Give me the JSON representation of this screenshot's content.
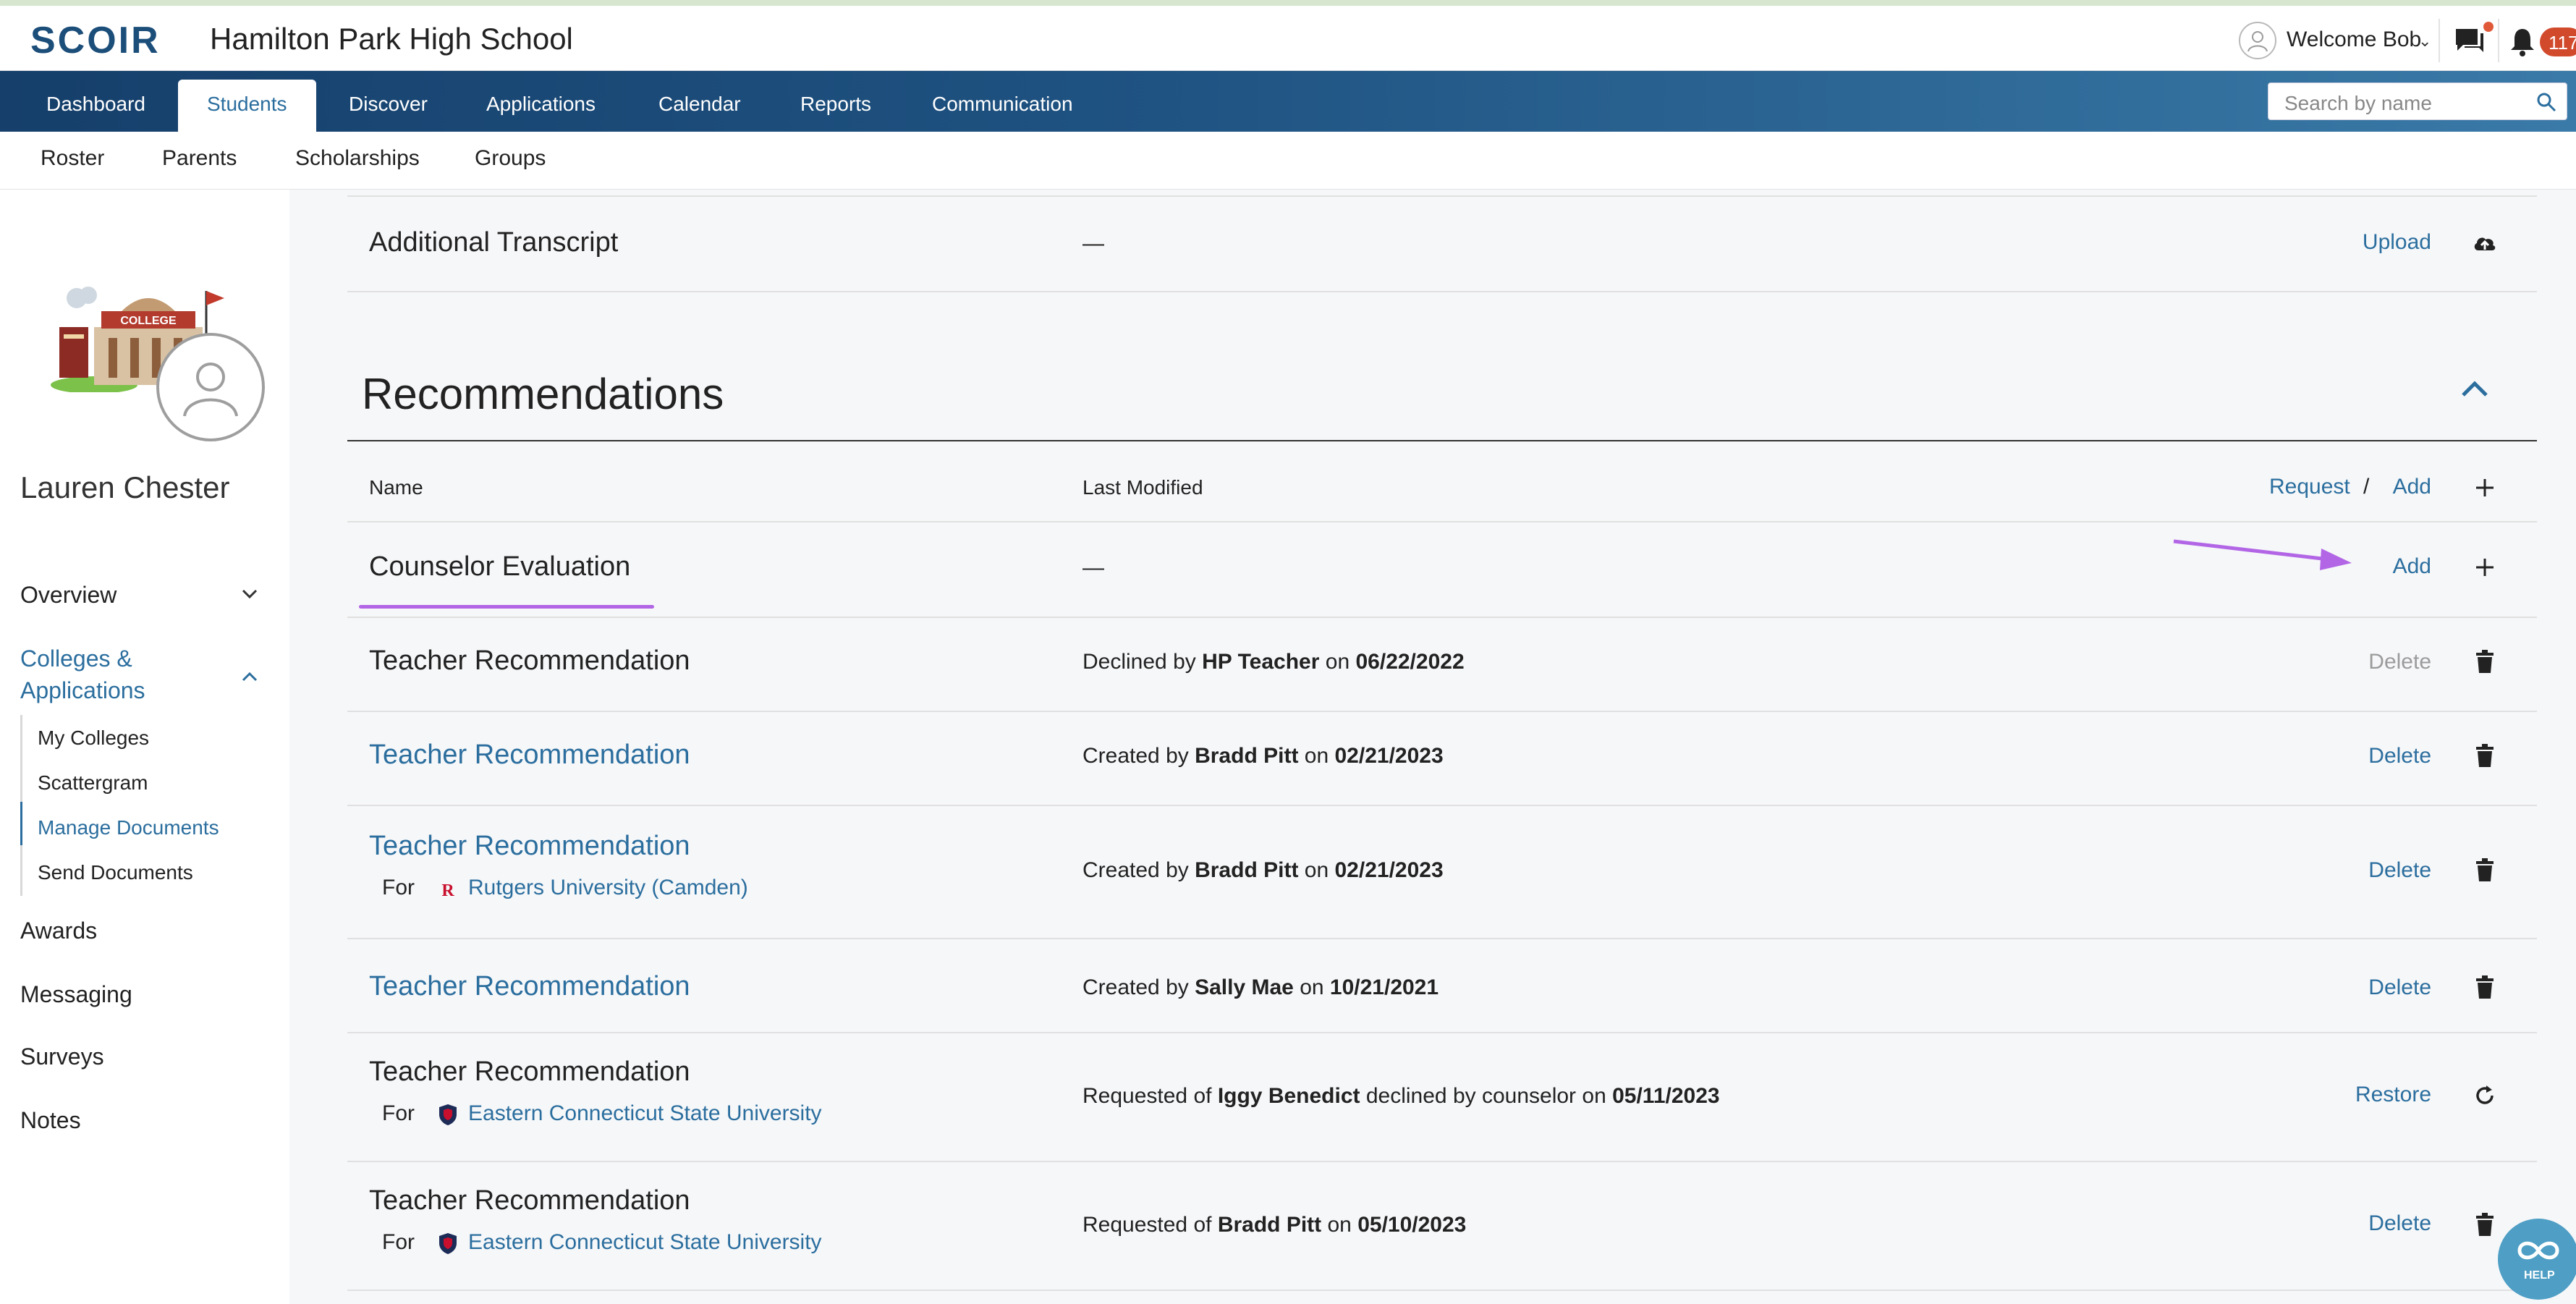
{
  "header": {
    "logo": "SCOIR",
    "school": "Hamilton Park High School",
    "welcome": "Welcome Bob",
    "notification_count": "117",
    "icons": [
      "user-avatar-icon",
      "chevron-down-icon",
      "chat-icon",
      "bell-icon"
    ]
  },
  "nav": {
    "tabs": [
      {
        "label": "Dashboard"
      },
      {
        "label": "Students"
      },
      {
        "label": "Discover"
      },
      {
        "label": "Applications"
      },
      {
        "label": "Calendar"
      },
      {
        "label": "Reports"
      },
      {
        "label": "Communication"
      }
    ],
    "search_placeholder": "Search by name"
  },
  "subnav": {
    "items": [
      {
        "label": "Roster"
      },
      {
        "label": "Parents"
      },
      {
        "label": "Scholarships"
      },
      {
        "label": "Groups"
      }
    ]
  },
  "sidebar": {
    "student_name": "Lauren Chester",
    "overview": "Overview",
    "colleges_line1": "Colleges &",
    "colleges_line2": "Applications",
    "sub_items": [
      {
        "label": "My Colleges"
      },
      {
        "label": "Scattergram"
      },
      {
        "label": "Manage Documents"
      },
      {
        "label": "Send Documents"
      }
    ],
    "awards": "Awards",
    "messaging": "Messaging",
    "surveys": "Surveys",
    "notes": "Notes"
  },
  "transcript": {
    "name": "Additional Transcript",
    "modified": "—",
    "action": "Upload"
  },
  "recommendations": {
    "title": "Recommendations",
    "col_name": "Name",
    "col_modified": "Last Modified",
    "request": "Request",
    "separator": "/",
    "add": "Add",
    "rows": [
      {
        "name": "Counselor Evaluation",
        "modified": "—",
        "action": "Add"
      },
      {
        "name": "Teacher Recommendation",
        "prefix": "Declined by",
        "person": "HP Teacher",
        "on": "on",
        "date": "06/22/2022",
        "action": "Delete"
      },
      {
        "name": "Teacher Recommendation",
        "prefix": "Created by",
        "person": "Bradd Pitt",
        "on": "on",
        "date": "02/21/2023",
        "action": "Delete"
      },
      {
        "name": "Teacher Recommendation",
        "for_label": "For",
        "for_college": "Rutgers University (Camden)",
        "prefix": "Created by",
        "person": "Bradd Pitt",
        "on": "on",
        "date": "02/21/2023",
        "action": "Delete"
      },
      {
        "name": "Teacher Recommendation",
        "prefix": "Created by",
        "person": "Sally Mae",
        "on": "on",
        "date": "10/21/2021",
        "action": "Delete"
      },
      {
        "name": "Teacher Recommendation",
        "for_label": "For",
        "for_college": "Eastern Connecticut State University",
        "prefix": "Requested of",
        "person": "Iggy Benedict",
        "on": "declined by counselor on",
        "date": "05/11/2023",
        "action": "Restore"
      },
      {
        "name": "Teacher Recommendation",
        "for_label": "For",
        "for_college": "Eastern Connecticut State University",
        "prefix": "Requested of",
        "person": "Bradd Pitt",
        "on": "on",
        "date": "05/10/2023",
        "action": "Delete"
      }
    ]
  },
  "help": {
    "label": "HELP"
  },
  "colors": {
    "brand": "#1c4e7a",
    "link": "#2b6e9e",
    "annotation": "#b266e6",
    "badge": "#d14a2c"
  }
}
